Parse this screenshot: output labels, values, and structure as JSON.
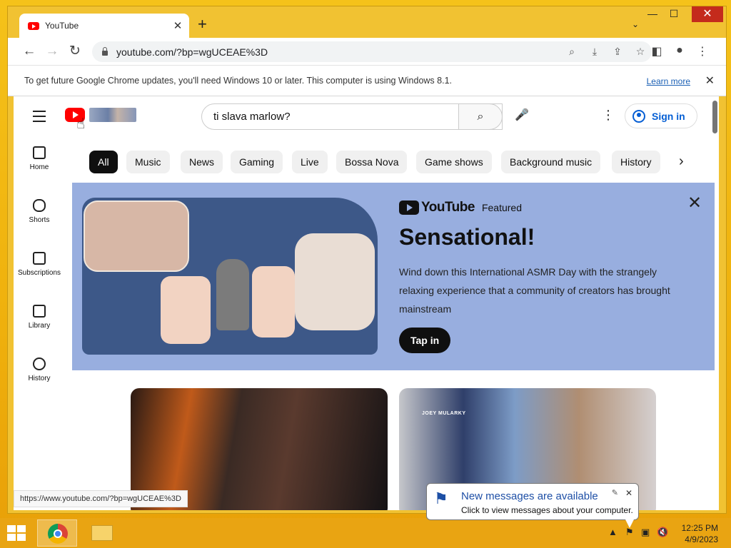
{
  "browser": {
    "tab_title": "YouTube",
    "url": "youtube.com/?bp=wgUCEAE%3D",
    "status_url": "https://www.youtube.com/?bp=wgUCEAE%3D",
    "infobar_text": "To get future Google Chrome updates, you'll need Windows 10 or later. This computer is using Windows 8.1.",
    "infobar_link": "Learn more"
  },
  "youtube": {
    "search_value": "ti slava marlow?",
    "sign_in": "Sign in",
    "guide": [
      {
        "label": "Home"
      },
      {
        "label": "Shorts"
      },
      {
        "label": "Subscriptions"
      },
      {
        "label": "Library"
      },
      {
        "label": "History"
      }
    ],
    "chips": [
      "All",
      "Music",
      "News",
      "Gaming",
      "Live",
      "Bossa Nova",
      "Game shows",
      "Background music",
      "History"
    ],
    "banner": {
      "brand": "YouTube",
      "featured": "Featured",
      "title": "Sensational!",
      "description": "Wind down this International ASMR Day with the strangely relaxing experience that a community of creators has brought mainstream",
      "button": "Tap in"
    },
    "thumb_overlay": "JOEY MULARKY"
  },
  "taskbar": {
    "time": "12:25 PM",
    "date": "4/9/2023"
  },
  "notification": {
    "title": "New messages are available",
    "text": "Click to view messages about your computer."
  },
  "colors": {
    "desktop": "#f2b90f",
    "yt_red": "#ff0000",
    "link_blue": "#065fd4",
    "banner_bg": "#98aedf"
  }
}
